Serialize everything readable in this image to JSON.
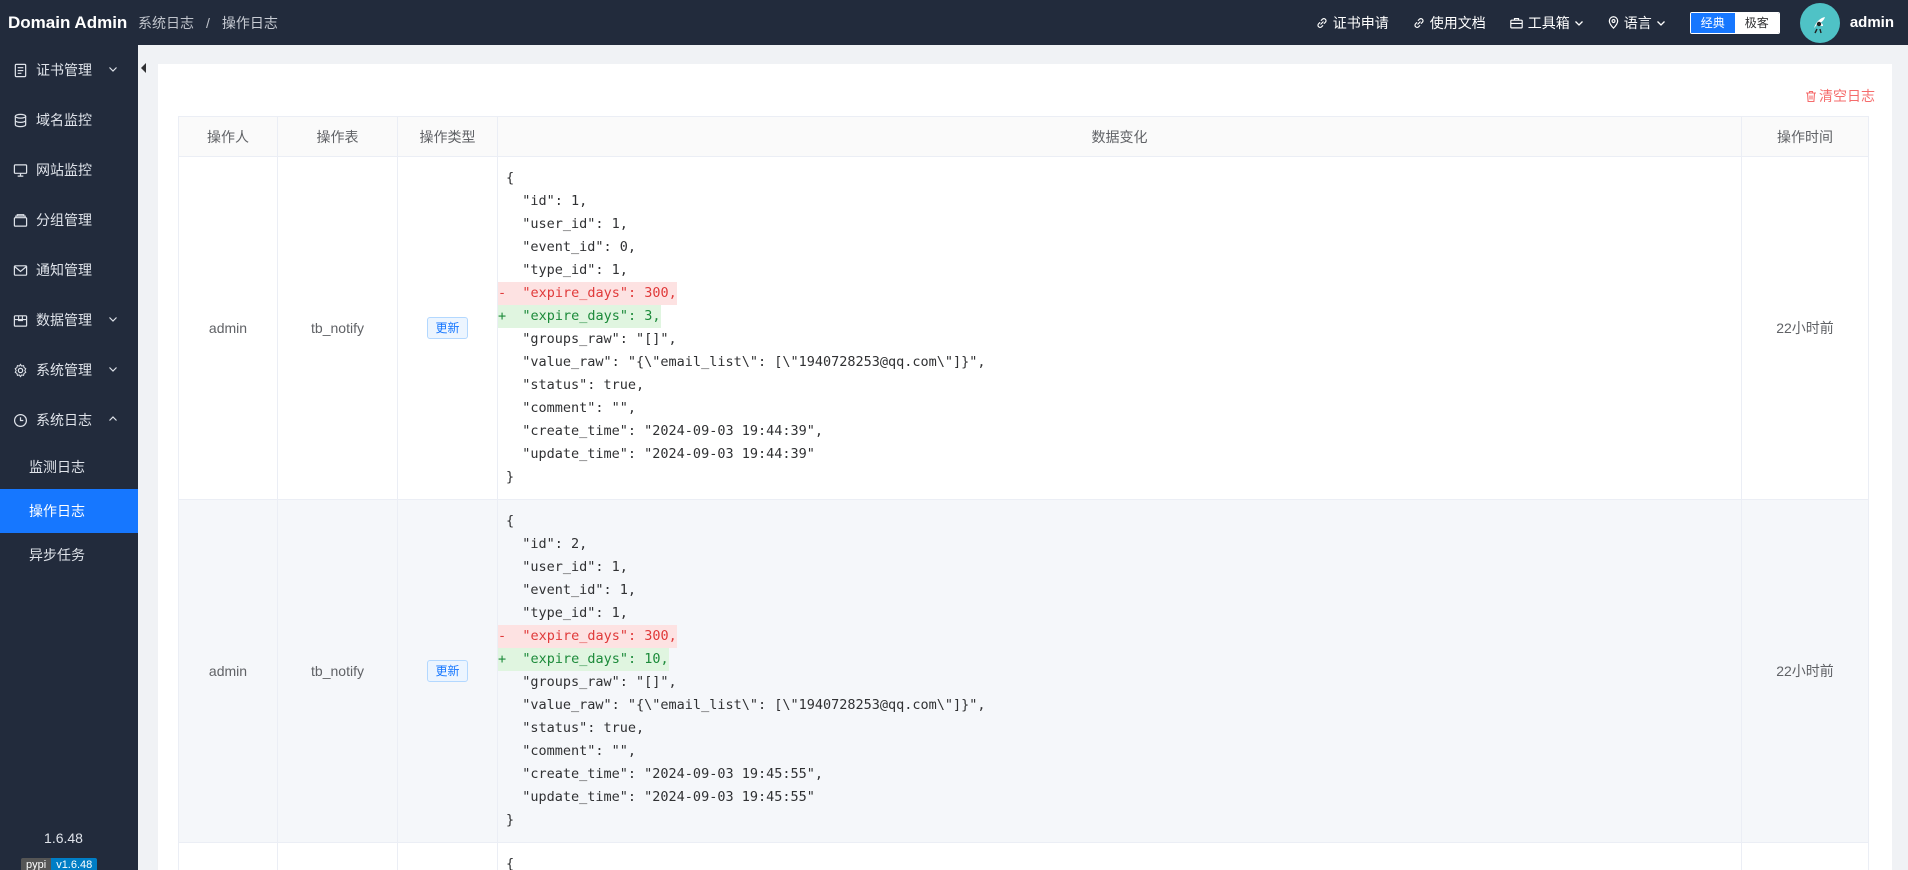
{
  "header": {
    "brand": "Domain Admin",
    "breadcrumb": [
      "系统日志",
      "操作日志"
    ],
    "links": {
      "cert_apply": "证书申请",
      "docs": "使用文档",
      "toolbox": "工具箱",
      "language": "语言"
    },
    "theme": {
      "classic": "经典",
      "geek": "极客"
    },
    "username": "admin"
  },
  "sidebar": {
    "items": [
      {
        "label": "证书管理",
        "icon": "document-icon",
        "expandable": true
      },
      {
        "label": "域名监控",
        "icon": "database-icon",
        "expandable": false
      },
      {
        "label": "网站监控",
        "icon": "monitor-icon",
        "expandable": false
      },
      {
        "label": "分组管理",
        "icon": "folder-icon",
        "expandable": false
      },
      {
        "label": "通知管理",
        "icon": "mail-icon",
        "expandable": false
      },
      {
        "label": "数据管理",
        "icon": "box-icon",
        "expandable": true
      },
      {
        "label": "系统管理",
        "icon": "gear-icon",
        "expandable": true
      },
      {
        "label": "系统日志",
        "icon": "clock-icon",
        "expandable": true,
        "expanded": true
      }
    ],
    "sub_items": [
      {
        "label": "监测日志",
        "active": false
      },
      {
        "label": "操作日志",
        "active": true
      },
      {
        "label": "异步任务",
        "active": false
      }
    ],
    "version": "1.6.48",
    "badge": {
      "left": "pypi",
      "right": "v1.6.48"
    }
  },
  "main": {
    "clear_label": "清空日志",
    "columns": [
      "操作人",
      "操作表",
      "操作类型",
      "数据变化",
      "操作时间"
    ],
    "rows": [
      {
        "operator": "admin",
        "table": "tb_notify",
        "type": "更新",
        "time": "22小时前",
        "diff": [
          {
            "kind": "ctx",
            "text": "{"
          },
          {
            "kind": "ctx",
            "text": "  \"id\": 1,"
          },
          {
            "kind": "ctx",
            "text": "  \"user_id\": 1,"
          },
          {
            "kind": "ctx",
            "text": "  \"event_id\": 0,"
          },
          {
            "kind": "ctx",
            "text": "  \"type_id\": 1,"
          },
          {
            "kind": "del",
            "text": "-  \"expire_days\": 300,"
          },
          {
            "kind": "add",
            "text": "+  \"expire_days\": 3,"
          },
          {
            "kind": "ctx",
            "text": "  \"groups_raw\": \"[]\","
          },
          {
            "kind": "ctx",
            "text": "  \"value_raw\": \"{\\\"email_list\\\": [\\\"1940728253@qq.com\\\"]}\","
          },
          {
            "kind": "ctx",
            "text": "  \"status\": true,"
          },
          {
            "kind": "ctx",
            "text": "  \"comment\": \"\","
          },
          {
            "kind": "ctx",
            "text": "  \"create_time\": \"2024-09-03 19:44:39\","
          },
          {
            "kind": "ctx",
            "text": "  \"update_time\": \"2024-09-03 19:44:39\""
          },
          {
            "kind": "ctx",
            "text": "}"
          }
        ]
      },
      {
        "operator": "admin",
        "table": "tb_notify",
        "type": "更新",
        "time": "22小时前",
        "diff": [
          {
            "kind": "ctx",
            "text": "{"
          },
          {
            "kind": "ctx",
            "text": "  \"id\": 2,"
          },
          {
            "kind": "ctx",
            "text": "  \"user_id\": 1,"
          },
          {
            "kind": "ctx",
            "text": "  \"event_id\": 1,"
          },
          {
            "kind": "ctx",
            "text": "  \"type_id\": 1,"
          },
          {
            "kind": "del",
            "text": "-  \"expire_days\": 300,"
          },
          {
            "kind": "add",
            "text": "+  \"expire_days\": 10,"
          },
          {
            "kind": "ctx",
            "text": "  \"groups_raw\": \"[]\","
          },
          {
            "kind": "ctx",
            "text": "  \"value_raw\": \"{\\\"email_list\\\": [\\\"1940728253@qq.com\\\"]}\","
          },
          {
            "kind": "ctx",
            "text": "  \"status\": true,"
          },
          {
            "kind": "ctx",
            "text": "  \"comment\": \"\","
          },
          {
            "kind": "ctx",
            "text": "  \"create_time\": \"2024-09-03 19:45:55\","
          },
          {
            "kind": "ctx",
            "text": "  \"update_time\": \"2024-09-03 19:45:55\""
          },
          {
            "kind": "ctx",
            "text": "}"
          }
        ]
      },
      {
        "operator": "",
        "table": "",
        "type": "",
        "time": "",
        "diff": [
          {
            "kind": "ctx",
            "text": "{"
          }
        ]
      }
    ]
  }
}
